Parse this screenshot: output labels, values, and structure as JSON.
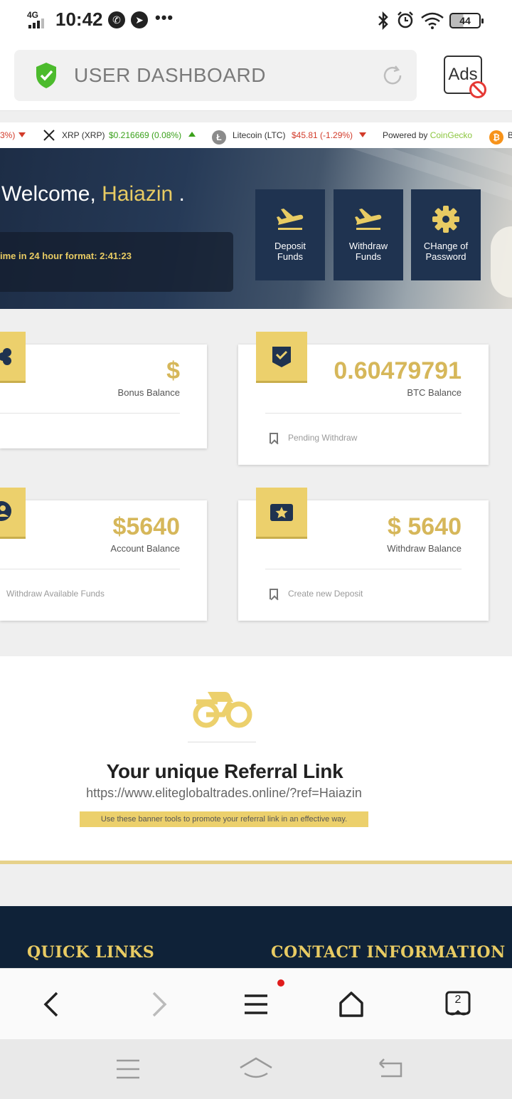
{
  "status_bar": {
    "network": "4G",
    "time": "10:42",
    "battery": "44",
    "icons": [
      "whatsapp-icon",
      "messenger-icon",
      "bluetooth-icon",
      "alarm-icon",
      "wifi-icon"
    ]
  },
  "browser": {
    "url_title": "USER DASHBOARD",
    "ads_label": "Ads",
    "tab_count": "2"
  },
  "ticker": {
    "partial_prev": "3%)",
    "items": [
      {
        "name": "XRP (XRP)",
        "price": "$0.216669 (0.08%)",
        "direction": "up"
      },
      {
        "name": "Litecoin (LTC)",
        "price": "$45.81 (-1.29%)",
        "direction": "down"
      }
    ],
    "powered_prefix": "Powered by ",
    "powered_brand": "CoinGecko",
    "next_partial": "B"
  },
  "hero": {
    "welcome_prefix": "Welcome, ",
    "username": "Haiazin",
    "welcome_suffix": " .",
    "time_text": "ime in 24 hour format: 2:41:23",
    "buttons": [
      {
        "line1": "Deposit",
        "line2": "Funds",
        "icon": "plane-takeoff-icon"
      },
      {
        "line1": "Withdraw",
        "line2": "Funds",
        "icon": "plane-takeoff-icon"
      },
      {
        "line1": "CHange of",
        "line2": "Password",
        "icon": "gear-icon"
      }
    ]
  },
  "cards": {
    "bonus": {
      "amount": "$",
      "caption": "Bonus Balance"
    },
    "btc": {
      "amount": "0.60479791",
      "caption": "BTC Balance",
      "footer": "Pending Withdraw"
    },
    "account": {
      "amount": "$5640",
      "caption": "Account Balance",
      "footer": "Withdraw Available Funds"
    },
    "withdraw": {
      "amount": "$ 5640",
      "caption": "Withdraw Balance",
      "footer": "Create new Deposit"
    }
  },
  "referral": {
    "title": "Your unique Referral Link",
    "url": "https://www.eliteglobaltrades.online/?ref=Haiazin",
    "note": "Use these banner tools to promote your referral link in an effective way."
  },
  "footer": {
    "quick_links": "QUICK LINKS",
    "contact": "CONTACT INFORMATION"
  },
  "colors": {
    "gold": "#e8cb63",
    "navy": "#1f3350",
    "badge": "#ecd06c",
    "up": "#3aa11b",
    "down": "#d23b2a"
  }
}
